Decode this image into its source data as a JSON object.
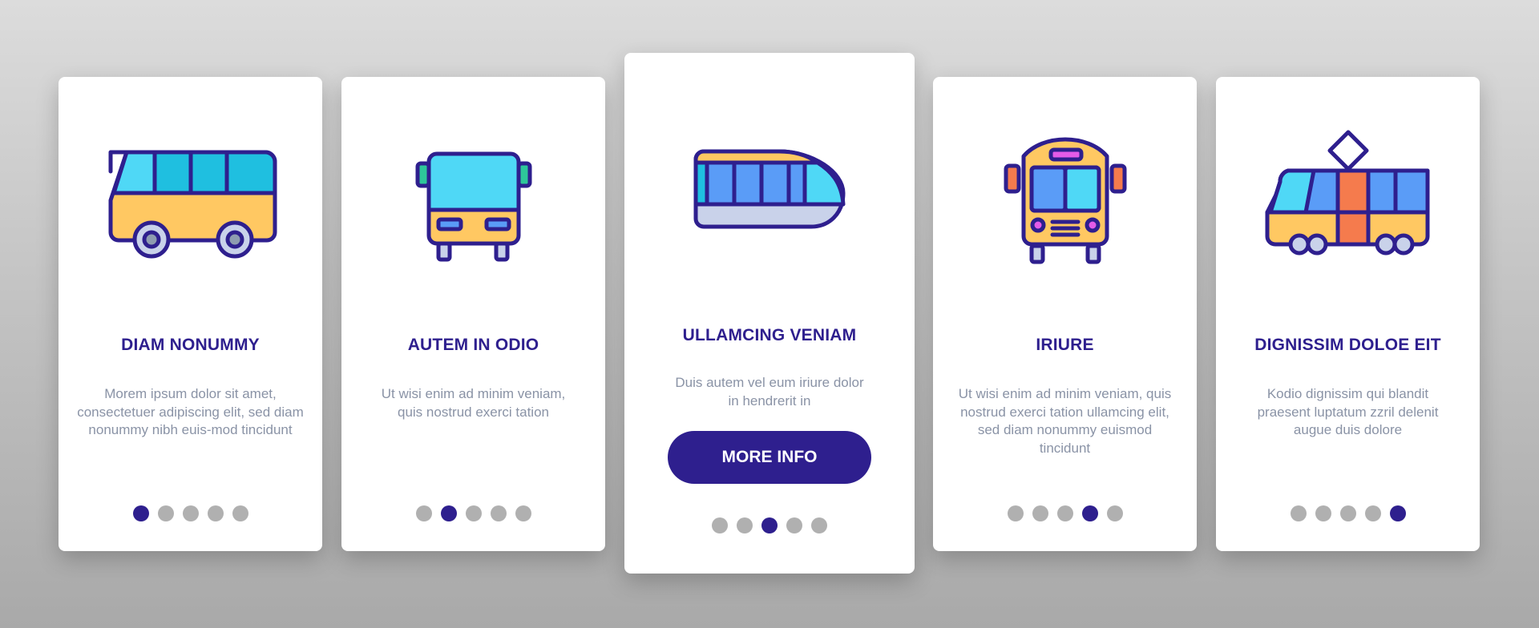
{
  "colors": {
    "accent": "#2e1f8e",
    "dot_inactive": "#b0b0b0",
    "text_muted": "#8a93a6",
    "icon_yellow": "#ffc862",
    "icon_cyan": "#4fd8f6",
    "icon_blue": "#5a9cf7",
    "icon_orange": "#f57b4d"
  },
  "cards": [
    {
      "icon": "bus-side-icon",
      "title": "DIAM NONUMMY",
      "description": "Morem ipsum dolor sit amet, consectetuer adipiscing elit, sed diam nonummy nibh euis-mod tincidunt",
      "active_page": 1,
      "total_pages": 5
    },
    {
      "icon": "bus-front-icon",
      "title": "AUTEM IN ODIO",
      "description": "Ut wisi enim ad minim veniam, quis nostrud exerci tation",
      "active_page": 2,
      "total_pages": 5
    },
    {
      "icon": "train-icon",
      "title": "ULLAMCING VENIAM",
      "description": "Duis autem vel eum iriure dolor in hendrerit in",
      "button_label": "MORE INFO",
      "active_page": 3,
      "total_pages": 5
    },
    {
      "icon": "school-bus-icon",
      "title": "IRIURE",
      "description": "Ut wisi enim ad minim veniam, quis nostrud exerci tation ullamcing elit, sed diam nonummy euismod tincidunt",
      "active_page": 4,
      "total_pages": 5
    },
    {
      "icon": "tram-icon",
      "title": "DIGNISSIM DOLOE EIT",
      "description": "Kodio dignissim qui blandit praesent luptatum zzril delenit augue duis dolore",
      "active_page": 5,
      "total_pages": 5
    }
  ]
}
